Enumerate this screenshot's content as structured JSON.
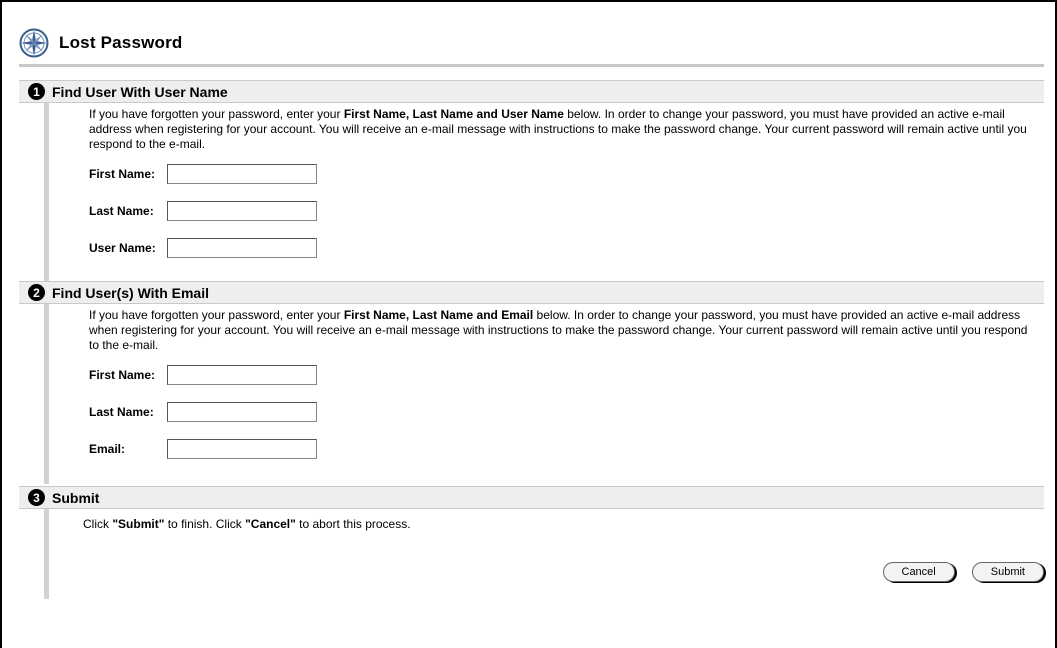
{
  "page": {
    "title": "Lost Password",
    "logo_icon": "compass-icon"
  },
  "sections": [
    {
      "number": "1",
      "title": "Find User With User Name",
      "desc_pre": "If you have forgotten your password, enter your ",
      "desc_bold": "First Name, Last Name and User Name",
      "desc_post": " below. In order to change your password, you must have provided an active e-mail address when registering for your account. You will receive an e-mail message with instructions to make the password change. Your current password will remain active until you respond to the e-mail.",
      "fields": [
        {
          "label": "First Name:",
          "value": ""
        },
        {
          "label": "Last Name:",
          "value": ""
        },
        {
          "label": "User Name:",
          "value": ""
        }
      ]
    },
    {
      "number": "2",
      "title": "Find User(s) With Email",
      "desc_pre": "If you have forgotten your password, enter your ",
      "desc_bold": "First Name, Last Name and Email",
      "desc_post": " below. In order to change your password, you must have provided an active e-mail address when registering for your account. You will receive an e-mail message with instructions to make the password change. Your current password will remain active until you respond to the e-mail.",
      "fields": [
        {
          "label": "First Name:",
          "value": ""
        },
        {
          "label": "Last Name:",
          "value": ""
        },
        {
          "label": "Email:",
          "value": ""
        }
      ]
    },
    {
      "number": "3",
      "title": "Submit",
      "text_1": "Click ",
      "text_2": "\"Submit\"",
      "text_3": " to finish. Click ",
      "text_4": "\"Cancel\"",
      "text_5": " to abort this process.",
      "cancel_label": "Cancel",
      "submit_label": "Submit"
    }
  ]
}
